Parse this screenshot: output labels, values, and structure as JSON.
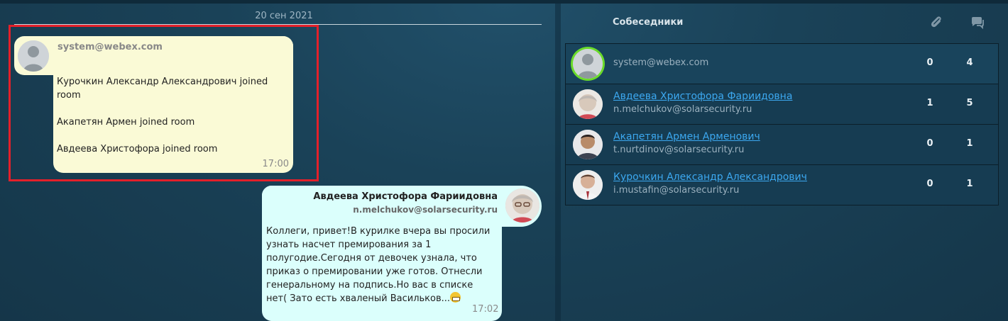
{
  "chat": {
    "date_label": "20 сен 2021",
    "system_message": {
      "sender": "system@webex.com",
      "lines": [
        "Курочкин Александр Александрович joined room",
        "Акапетян Армен joined room",
        "Авдеева Христофора joined room"
      ],
      "time": "17:00"
    },
    "user_message": {
      "sender_name": "Авдеева Христофора Фариидовна",
      "sender_email": "n.melchukov@solarsecurity.ru",
      "text": "Коллеги, привет!В курилке вчера вы просили узнать насчет премирования за 1 полугодие.Сегодня от девочек узнала, что приказ о премировании уже готов. Отнесли генеральному на подпись.Но вас в списке нет( Зато есть хваленый Васильков...",
      "emoji": "grimacing-face",
      "time": "17:02"
    }
  },
  "participants": {
    "title": "Собеседники",
    "header_icons": [
      "paperclip-icon",
      "chat-bubbles-icon"
    ],
    "rows": [
      {
        "name": "",
        "email": "system@webex.com",
        "attachments": "0",
        "messages": "4",
        "online": true
      },
      {
        "name": "Авдеева Христофора Фариидовна",
        "email": "n.melchukov@solarsecurity.ru",
        "attachments": "1",
        "messages": "5",
        "online": false
      },
      {
        "name": "Акапетян Армен Арменович",
        "email": "t.nurtdinov@solarsecurity.ru",
        "attachments": "0",
        "messages": "1",
        "online": false
      },
      {
        "name": "Курочкин Александр Александрович",
        "email": "i.mustafin@solarsecurity.ru",
        "attachments": "0",
        "messages": "1",
        "online": false
      }
    ]
  },
  "colors": {
    "highlight_border": "#e3202a",
    "system_bubble": "#fafad6",
    "user_bubble": "#dbfffc",
    "link": "#3ca8f0",
    "online_ring": "#6adb2a"
  }
}
